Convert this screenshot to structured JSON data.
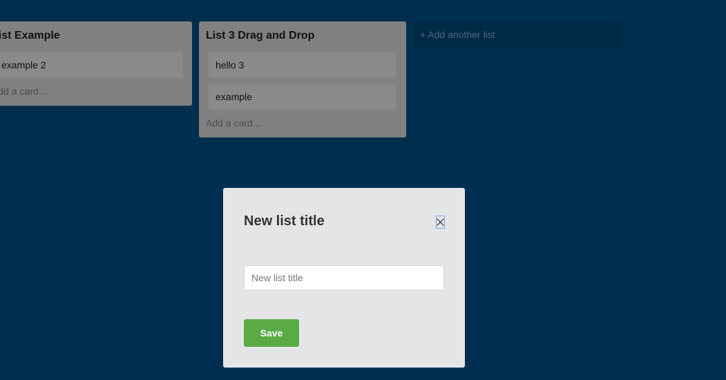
{
  "board": {
    "lists": [
      {
        "title": "List Example",
        "cards": [
          "example 2"
        ],
        "add_card_label": "Add a card..."
      },
      {
        "title": "List 3 Drag and Drop",
        "cards": [
          "hello 3",
          "example"
        ],
        "add_card_label": "Add a card..."
      }
    ],
    "add_list_label": "+ Add another list"
  },
  "modal": {
    "title": "New list title",
    "input_placeholder": "New list title",
    "input_value": "",
    "save_label": "Save",
    "close_icon": "close-icon"
  },
  "colors": {
    "background": "#002e4e",
    "list_bg": "#808080",
    "modal_bg": "#e4e5e7",
    "save_button": "#5aab46"
  }
}
